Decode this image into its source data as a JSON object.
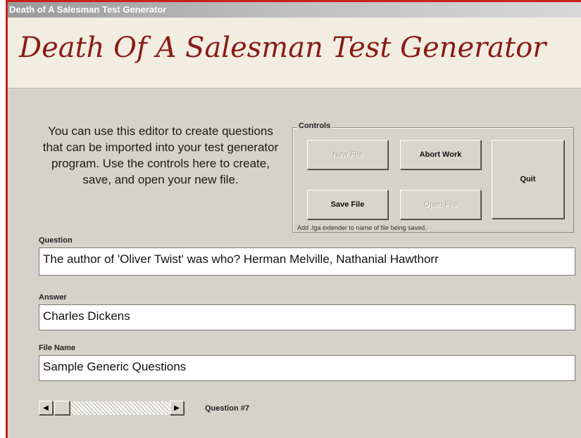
{
  "window": {
    "title": "Death of A Salesman Test Generator"
  },
  "banner": {
    "title": "Death Of A Salesman Test Generator"
  },
  "intro": {
    "text": "You can use this editor to create questions that can be imported into your test generator program. Use the controls here to create, save, and open your new file."
  },
  "controls": {
    "legend": "Controls",
    "new_file_label": "New File",
    "abort_work_label": "Abort Work",
    "quit_label": "Quit",
    "save_file_label": "Save File",
    "open_file_label": "Open File",
    "note": "Add .tga extender to name of file being saved."
  },
  "question": {
    "label": "Question",
    "value": "The author of 'Oliver Twist' was who? Herman Melville, Nathanial Hawthorr"
  },
  "answer": {
    "label": "Answer",
    "value": "Charles Dickens"
  },
  "file_name": {
    "label": "File Name",
    "value": "Sample Generic Questions"
  },
  "navigation": {
    "left_arrow_icon": "triangle-left-icon",
    "right_arrow_icon": "triangle-right-icon",
    "question_number": "Question #7"
  },
  "colors": {
    "window_border": "#cc1f1f",
    "banner_background": "#f1ede1",
    "banner_title": "#8a1a16",
    "form_background": "#d5d2ca"
  }
}
